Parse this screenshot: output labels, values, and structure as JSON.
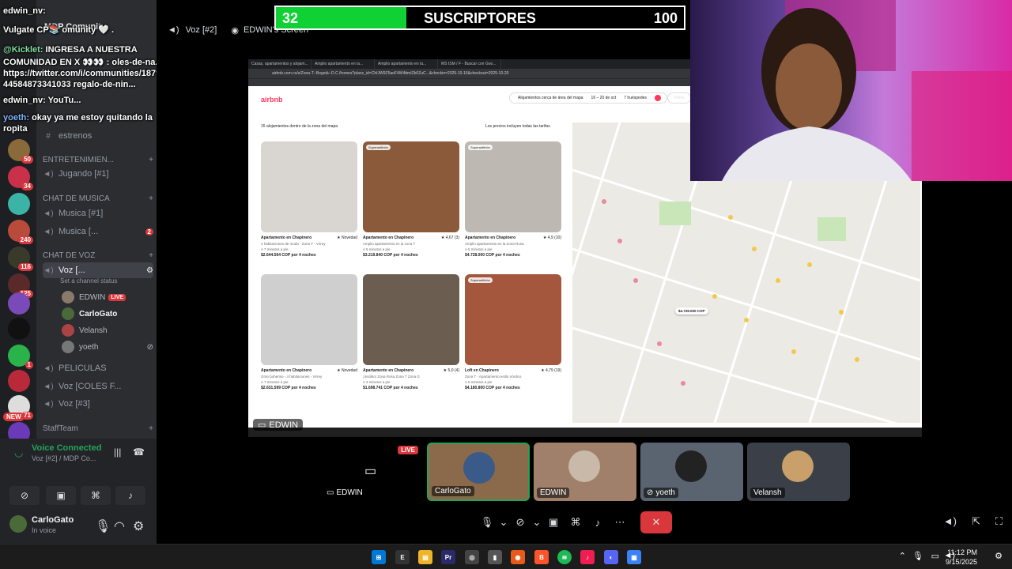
{
  "subscriber_bar": {
    "current": "32",
    "title": "SUSCRIPTORES",
    "goal": "100",
    "progress": 0.32,
    "fill_color": "#0fd133"
  },
  "chat_overlay": {
    "line1_user": "edwin_nv:",
    "line2": "Vulgate CP📚 omunity 🤍 .",
    "line3_user": "@Kicklet:",
    "line3_text": "INGRESA A NUESTRA",
    "line4": "COMUNIDAD EN X 👀👀 : oles-de-na...",
    "line5": "https://twitter.com/i/communities/18797",
    "line6": "44584873341033  regalo-de-nin...",
    "line7_user": "edwin_nv:",
    "line7_text": "YouTu...",
    "line8_user": "yoeth:",
    "line8_text": "okay ya me estoy quitando la",
    "line9": "ropita"
  },
  "sidebar": {
    "header": "MDP Comunity",
    "channels": [
      {
        "name": "estrenos"
      },
      {
        "category": "ENTRETENIMIEN..."
      },
      {
        "name": "Jugando [#1]"
      },
      {
        "category": "CHAT DE MUSICA"
      },
      {
        "name": "Musica [#1]"
      },
      {
        "name": "Musica [...",
        "badge": "2"
      },
      {
        "category": "CHAT DE VOZ"
      },
      {
        "name": "Voz [..."
      },
      {
        "status": "Set a channel status"
      },
      {
        "name": "PELICULAS"
      },
      {
        "name": "Voz [COLES F..."
      },
      {
        "name": "Voz [#3]"
      },
      {
        "category": "StaffTeam"
      }
    ],
    "voice_users": [
      {
        "name": "EDWIN",
        "live": "LIVE"
      },
      {
        "name": "CarloGato"
      },
      {
        "name": "Velansh"
      },
      {
        "name": "yoeth"
      }
    ],
    "server_badges": [
      "50",
      "34",
      "240",
      "116",
      "125",
      "1",
      "71",
      "261"
    ],
    "new_badge": "NEW"
  },
  "voice_panel": {
    "status": "Voice Connected",
    "channel": "Voz [#2] / MDP Co...",
    "user": "CarloGato",
    "user_status": "In voice"
  },
  "stage": {
    "channel_name": "Voz [#2]",
    "stream_owner": "EDWIN's Screen",
    "stream_label": "EDWIN"
  },
  "browser": {
    "tabs": [
      "Casas, apartamentos y alojam...",
      "Amplio apartamento en la...",
      "Amplio apartamento en la...",
      "MS ISM / F - Buscar con Goo..."
    ],
    "url": "airbnb.com.co/s/Zona-T--Bogotá--D.C./homes?place_id=ChIJW9Z5aoF4W4ttmIZb0ZuC...&checkin=2025-10-16&checkout=2025-10-20",
    "logo": "airbnb",
    "search_where": "Alojamientos cerca de área del mapa",
    "search_dates": "16 – 20 de oct",
    "search_guests": "7 huéspedes",
    "filter": "Filtros",
    "count_text": "15 alojamientos dentro de la zona del mapa",
    "prices_text": "Los precios incluyen todas las tarifas",
    "listings": [
      {
        "title": "Apartamento en Chapinero",
        "rating": "★ Novedad",
        "desc": "4 habitaciones de moda - Zona T - Virrey",
        "dist": "A 7 minutos a pie",
        "price": "$2.644.564 COP por 4 noches",
        "superhost": "",
        "color": "#d9d6d2"
      },
      {
        "title": "Apartamento en Chapinero",
        "rating": "★ 4,67 (3)",
        "desc": "Amplio apartamento en la zona T",
        "dist": "A 5 minutos a pie",
        "price": "$3.219.840 COP por 4 noches",
        "superhost": "Superanfitrión",
        "color": "#8a5a3a"
      },
      {
        "title": "Apartamento en Chapinero",
        "rating": "★ 4,9 (10)",
        "desc": "Amplio apartamento en la Zona Rosa",
        "dist": "A 5 minutos a pie",
        "price": "$4.728.000 COP por 4 noches",
        "superhost": "Superanfitrión",
        "color": "#bdb8b1"
      },
      {
        "title": "Apartamento en Chapinero",
        "rating": "★ Novedad",
        "desc": "Gran bohemio - 4 habitaciones - Virrey",
        "dist": "A 7 minutos a pie",
        "price": "$2.631.599 COP por 4 noches",
        "superhost": "",
        "color": "#cfcfcf"
      },
      {
        "title": "Apartamento en Chapinero",
        "rating": "★ 5,0 (4)",
        "desc": "¡Insólito! Zona Rosa Zona T Zona G",
        "dist": "A 3 minutos a pie",
        "price": "$1.698.741 COP por 4 noches",
        "superhost": "",
        "color": "#6b5e50"
      },
      {
        "title": "Loft en Chapinero",
        "rating": "★ 4,79 (19)",
        "desc": "Zona T - Apartamento estilo nórdico",
        "dist": "A 5 minutos a pie",
        "price": "$4.180.800 COP por 4 noches",
        "superhost": "Superanfitrión",
        "color": "#a4573d"
      }
    ],
    "map_pin": "$4.728.000 COP"
  },
  "participants": [
    {
      "name": "EDWIN",
      "live": "LIVE"
    },
    {
      "name": "CarloGato"
    },
    {
      "name": "EDWIN"
    },
    {
      "name": "yoeth"
    },
    {
      "name": "Velansh"
    }
  ],
  "taskbar": {
    "time": "11:12 PM",
    "date": "9/15/2025"
  }
}
